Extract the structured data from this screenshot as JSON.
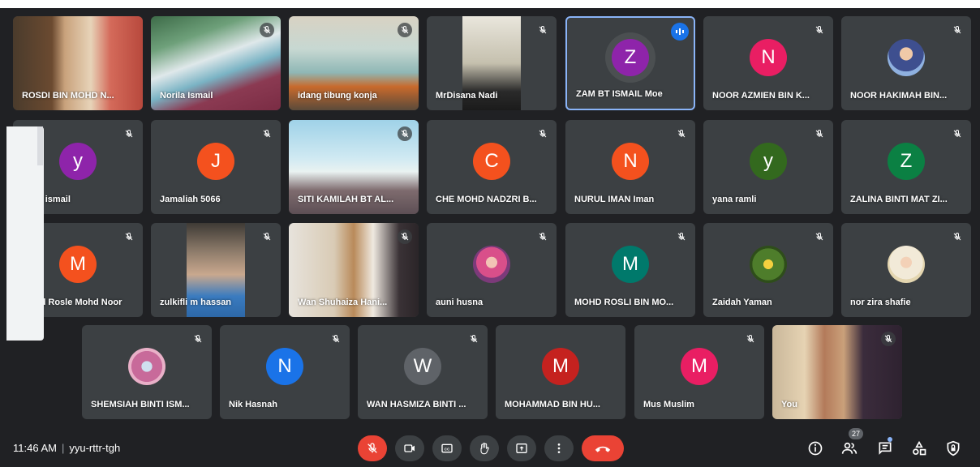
{
  "meeting": {
    "time": "11:46 AM",
    "code": "yyu-rttr-tgh",
    "participant_count": "27"
  },
  "participants": [
    {
      "name": "ROSDI BIN MOHD N..."
    },
    {
      "name": "Norila Ismail"
    },
    {
      "name": "idang tibung konja"
    },
    {
      "name": "MrDisana Nadi"
    },
    {
      "name": "ZAM BT ISMAIL Moe",
      "initial": "Z"
    },
    {
      "name": "NOOR AZMIEN BIN K...",
      "initial": "N"
    },
    {
      "name": "NOOR HAKIMAH BIN..."
    },
    {
      "name": "yuan ismail",
      "initial": "y"
    },
    {
      "name": "Jamaliah 5066",
      "initial": "J"
    },
    {
      "name": "SITI KAMILAH BT AL..."
    },
    {
      "name": "CHE MOHD NADZRI B...",
      "initial": "C"
    },
    {
      "name": "NURUL IMAN Iman",
      "initial": "N"
    },
    {
      "name": "yana ramli",
      "initial": "y"
    },
    {
      "name": "ZALINA BINTI MAT ZI...",
      "initial": "Z"
    },
    {
      "name": "Mohd Rosle Mohd Noor",
      "initial": "M"
    },
    {
      "name": "zulkifli m hassan"
    },
    {
      "name": "Wan Shuhaiza Hani..."
    },
    {
      "name": "auni husna"
    },
    {
      "name": "MOHD ROSLI BIN MO...",
      "initial": "M"
    },
    {
      "name": "Zaidah Yaman"
    },
    {
      "name": "nor zira shafie"
    },
    {
      "name": "SHEMSIAH BINTI ISM..."
    },
    {
      "name": "Nik Hasnah",
      "initial": "N"
    },
    {
      "name": "WAN HASMIZA BINTI ...",
      "initial": "W"
    },
    {
      "name": "MOHAMMAD BIN HU...",
      "initial": "M"
    },
    {
      "name": "Mus Muslim",
      "initial": "M"
    },
    {
      "name": "You"
    }
  ],
  "colors": {
    "background": "#202124",
    "tile": "#3c4043",
    "speaking_border": "#8ab4f8",
    "mic_off_red": "#ea4335",
    "avatar_purple": "#8e24aa",
    "avatar_pink": "#e91e63",
    "avatar_orange": "#f4511e",
    "avatar_green": "#0b8043",
    "avatar_teal": "#00796b",
    "avatar_blue": "#1a73e8",
    "avatar_grey": "#5f6368",
    "avatar_red": "#c5221f",
    "avatar_olive": "#33691e"
  },
  "icons": [
    "mic-off-icon",
    "camera-icon",
    "captions-icon",
    "raise-hand-icon",
    "present-icon",
    "more-options-icon",
    "hang-up-icon",
    "info-icon",
    "people-icon",
    "chat-icon",
    "activities-icon",
    "host-controls-icon",
    "speaking-indicator-icon"
  ]
}
